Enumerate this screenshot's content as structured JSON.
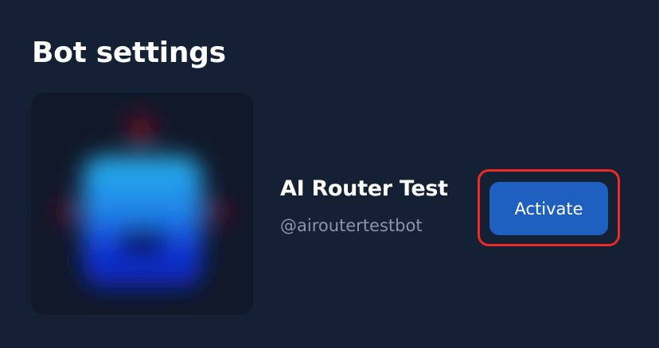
{
  "page": {
    "title": "Bot settings"
  },
  "bot": {
    "name": "AI Router Test",
    "handle": "@airoutertestbot",
    "avatar_icon": "blurred-robot-avatar"
  },
  "actions": {
    "activate_label": "Activate"
  },
  "colors": {
    "background": "#142033",
    "button": "#1f5fbf",
    "highlight": "#ee2a24",
    "handle_text": "#8b95a7"
  }
}
